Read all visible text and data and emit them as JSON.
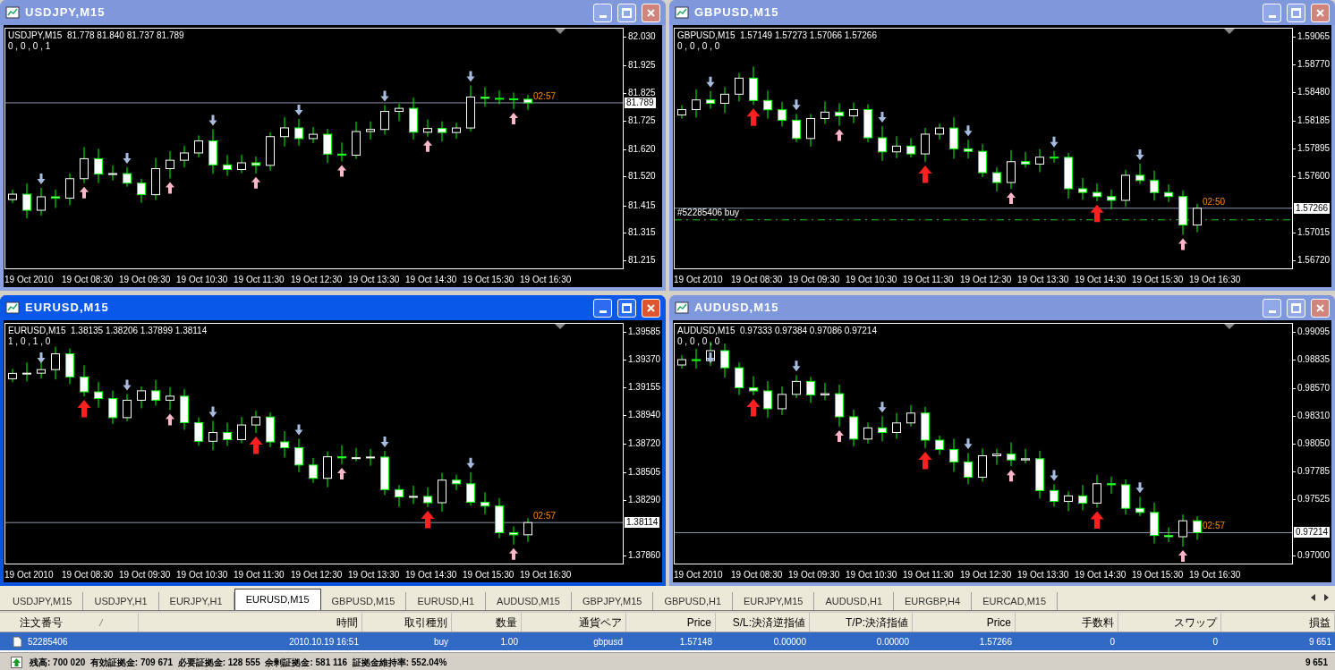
{
  "charts": [
    {
      "title": "USDJPY,M15",
      "active": false,
      "header": "USDJPY,M15  81.778 81.840 81.737 81.789",
      "indicators": "0 , 0 , 0 , 1",
      "yticks": [
        "82.030",
        "81.925",
        "81.825",
        "81.725",
        "81.620",
        "81.520",
        "81.415",
        "81.315",
        "81.215"
      ],
      "price_tag": "81.789",
      "timer": "02:57",
      "xlabels": [
        "19 Oct 2010",
        "19 Oct 08:30",
        "19 Oct 09:30",
        "19 Oct 10:30",
        "19 Oct 11:30",
        "19 Oct 12:30",
        "19 Oct 13:30",
        "19 Oct 14:30",
        "19 Oct 15:30",
        "19 Oct 16:30"
      ]
    },
    {
      "title": "GBPUSD,M15",
      "active": false,
      "header": "GBPUSD,M15  1.57149 1.57273 1.57066 1.57266",
      "indicators": "0 , 0 , 0 , 0",
      "yticks": [
        "1.59065",
        "1.58770",
        "1.58480",
        "1.58185",
        "1.57895",
        "1.57600",
        "1.57015",
        "1.56720"
      ],
      "price_tag": "1.57266",
      "timer": "02:50",
      "order_label": "#52285406 buy",
      "xlabels": [
        "19 Oct 2010",
        "19 Oct 08:30",
        "19 Oct 09:30",
        "19 Oct 10:30",
        "19 Oct 11:30",
        "19 Oct 12:30",
        "19 Oct 13:30",
        "19 Oct 14:30",
        "19 Oct 15:30",
        "19 Oct 16:30"
      ]
    },
    {
      "title": "EURUSD,M15",
      "active": true,
      "header": "EURUSD,M15  1.38135 1.38206 1.37899 1.38114",
      "indicators": "1 , 0 , 1 , 0",
      "yticks": [
        "1.39585",
        "1.39370",
        "1.39155",
        "1.38940",
        "1.38720",
        "1.38505",
        "1.38290",
        "1.37860"
      ],
      "price_tag": "1.38114",
      "timer": "02:57",
      "xlabels": [
        "19 Oct 2010",
        "19 Oct 08:30",
        "19 Oct 09:30",
        "19 Oct 10:30",
        "19 Oct 11:30",
        "19 Oct 12:30",
        "19 Oct 13:30",
        "19 Oct 14:30",
        "19 Oct 15:30",
        "19 Oct 16:30"
      ]
    },
    {
      "title": "AUDUSD,M15",
      "active": false,
      "header": "AUDUSD,M15  0.97333 0.97384 0.97086 0.97214",
      "indicators": "0 , 0 , 0 , 0",
      "yticks": [
        "0.99095",
        "0.98835",
        "0.98570",
        "0.98310",
        "0.98050",
        "0.97785",
        "0.97525",
        "0.97000"
      ],
      "price_tag": "0.97214",
      "timer": "02:57",
      "xlabels": [
        "19 Oct 2010",
        "19 Oct 08:30",
        "19 Oct 09:30",
        "19 Oct 10:30",
        "19 Oct 11:30",
        "19 Oct 12:30",
        "19 Oct 13:30",
        "19 Oct 14:30",
        "19 Oct 15:30",
        "19 Oct 16:30"
      ]
    }
  ],
  "tabs": [
    {
      "label": "USDJPY,M15",
      "selected": false
    },
    {
      "label": "USDJPY,H1",
      "selected": false
    },
    {
      "label": "EURJPY,H1",
      "selected": false
    },
    {
      "label": "EURUSD,M15",
      "selected": true
    },
    {
      "label": "GBPUSD,M15",
      "selected": false
    },
    {
      "label": "EURUSD,H1",
      "selected": false
    },
    {
      "label": "AUDUSD,M15",
      "selected": false
    },
    {
      "label": "GBPJPY,M15",
      "selected": false
    },
    {
      "label": "GBPUSD,H1",
      "selected": false
    },
    {
      "label": "EURJPY,M15",
      "selected": false
    },
    {
      "label": "AUDUSD,H1",
      "selected": false
    },
    {
      "label": "EURGBP,H4",
      "selected": false
    },
    {
      "label": "EURCAD,M15",
      "selected": false
    }
  ],
  "terminal": {
    "columns": [
      "注文番号",
      "時間",
      "取引種別",
      "数量",
      "通貨ペア",
      "Price",
      "S/L:決済逆指値",
      "T/P:決済指値",
      "Price",
      "手数料",
      "スワップ",
      "損益"
    ],
    "rows": [
      {
        "selected": true,
        "cells": [
          "52285406",
          "2010.10.19 16:51",
          "buy",
          "1.00",
          "gbpusd",
          "1.57148",
          "0.00000",
          "0.00000",
          "1.57266",
          "0",
          "0",
          "9 651"
        ]
      }
    ],
    "status": "残高: 700 020  有効証拠金: 709 671  必要証拠金: 128 555  余剰証拠金: 581 116  証拠金維持率: 552.04%",
    "status_total": "9 651"
  }
}
